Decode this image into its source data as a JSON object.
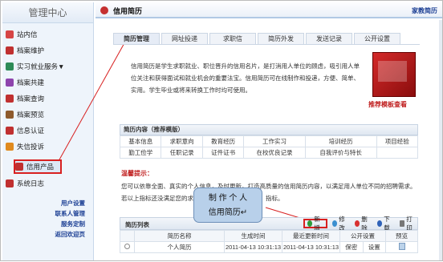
{
  "sidebar": {
    "title": "管理中心",
    "items": [
      {
        "label": "站内信",
        "color": "#d64545"
      },
      {
        "label": "档案维护",
        "color": "#c03030"
      },
      {
        "label": "实习就业服务▼",
        "color": "#2e8b57"
      },
      {
        "label": "档案共建",
        "color": "#8e44ad"
      },
      {
        "label": "档案查询",
        "color": "#c03030"
      },
      {
        "label": "档案预览",
        "color": "#8e5a2c"
      },
      {
        "label": "信息认证",
        "color": "#c03030"
      },
      {
        "label": "失信投诉",
        "color": "#e08a1e"
      },
      {
        "label": "信用产品",
        "color": "#c03030"
      },
      {
        "label": "系统日志",
        "color": "#c03030"
      }
    ],
    "links": [
      "用户设置",
      "联系人管理",
      "服务定制",
      "返回欢迎页"
    ]
  },
  "header": {
    "title": "信用简历",
    "right": "家教简历"
  },
  "tabs": [
    "简历管理",
    "网址投递",
    "求职信",
    "简历外发",
    "发送记录",
    "公开设置"
  ],
  "intro": "信用简历是学生求职就业、职位晋升的信用名片，是打消用人单位的顾虑，吸引用人单位关注和获得面试和就业机会的重要法宝。信用简历可在线制作和投递，方便、简单、实用。学生毕业或将来转换工作时均可使用。",
  "book_link": "推荐模板查看",
  "content_section": {
    "title": "简历内容（推荐模版）",
    "rows": [
      [
        "基本信息",
        "求职意向",
        "教育经历",
        "工作实习",
        "培训经历",
        "项目经验"
      ],
      [
        "勤工俭学",
        "任职记录",
        "证件证书",
        "在校优良记录",
        "自我评价与特长",
        ""
      ]
    ]
  },
  "tips": {
    "label": "温馨提示：",
    "text": "您可以依靠全面、真实的个人信息，及时更新，打造高质量的信用简历内容，以满足用人单位不同的招聘需求。若以上指标还没满足您的求职需求，可在此…（推荐）指标。"
  },
  "list": {
    "title": "简历列表",
    "buttons": [
      "新增",
      "修改",
      "删除",
      "下载",
      "打印"
    ],
    "columns": [
      "",
      "简历名称",
      "生成时间",
      "最近更新时间",
      "公开设置",
      "",
      "预览"
    ],
    "rows": [
      {
        "name": "个人简历",
        "created": "2011-04-13  10:31:13",
        "updated": "2011-04-13  10:31:13",
        "privacy": "保密",
        "setting": "设置"
      }
    ]
  },
  "callout": {
    "line1": "制 作 个 人",
    "line2": "信用简历↵"
  },
  "colors": {
    "accent": "#c02020",
    "link": "#1c3f94",
    "highlight": "#d82020"
  }
}
